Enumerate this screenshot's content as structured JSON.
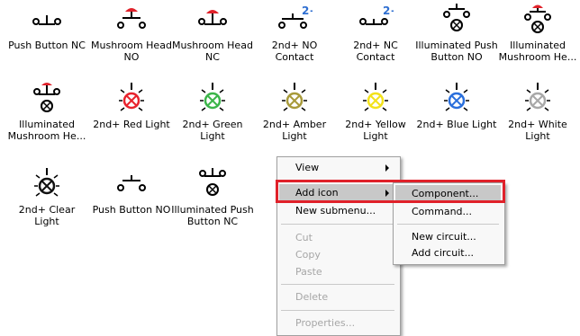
{
  "icons": [
    {
      "label": "Push Button NC",
      "icon": "push-button-nc-icon"
    },
    {
      "label": "Mushroom Head NO",
      "icon": "mushroom-head-no-icon",
      "accent": "#e0212a"
    },
    {
      "label": "Mushroom Head NC",
      "icon": "mushroom-head-nc-icon",
      "accent": "#e0212a"
    },
    {
      "label": "2nd+ NO Contact",
      "icon": "no-contact-icon",
      "badge": "2+"
    },
    {
      "label": "2nd+ NC Contact",
      "icon": "nc-contact-icon",
      "badge": "2+"
    },
    {
      "label": "Illuminated Push Button NO",
      "icon": "illuminated-push-button-no-icon"
    },
    {
      "label": "Illuminated Mushroom He...",
      "icon": "illuminated-mushroom-head-icon",
      "accent": "#e0212a"
    },
    {
      "label": "Illuminated Mushroom He...",
      "icon": "illuminated-mushroom-head-nc-icon",
      "accent": "#e0212a"
    },
    {
      "label": "2nd+ Red Light",
      "icon": "red-light-icon",
      "color": "#e8232d"
    },
    {
      "label": "2nd+ Green Light",
      "icon": "green-light-icon",
      "color": "#3cb54a"
    },
    {
      "label": "2nd+ Amber Light",
      "icon": "amber-light-icon",
      "color": "#a89a3a"
    },
    {
      "label": "2nd+ Yellow Light",
      "icon": "yellow-light-icon",
      "color": "#f3e21b"
    },
    {
      "label": "2nd+ Blue Light",
      "icon": "blue-light-icon",
      "color": "#2a6fdc"
    },
    {
      "label": "2nd+ White Light",
      "icon": "white-light-icon",
      "color": "#a8a8a8"
    },
    {
      "label": "2nd+ Clear Light",
      "icon": "clear-light-icon",
      "color": "#111111"
    },
    {
      "label": "Push Button NO",
      "icon": "push-button-no-icon"
    },
    {
      "label": "Illuminated Push Button NC",
      "icon": "illuminated-push-button-nc-icon"
    }
  ],
  "badge_color": "#2f6fd1",
  "context_menu": {
    "items": [
      {
        "label": "View",
        "submenu": true
      },
      {
        "label": "Add icon",
        "submenu": true,
        "highlighted": true
      },
      {
        "label": "New submenu..."
      },
      {
        "label": "Cut",
        "disabled": true
      },
      {
        "label": "Copy",
        "disabled": true
      },
      {
        "label": "Paste",
        "disabled": true
      },
      {
        "label": "Delete",
        "disabled": true
      },
      {
        "label": "Properties...",
        "disabled": true
      }
    ]
  },
  "submenu": {
    "items": [
      {
        "label": "Component...",
        "highlighted": true
      },
      {
        "label": "Command..."
      },
      {
        "label": "New circuit..."
      },
      {
        "label": "Add circuit..."
      }
    ]
  },
  "highlight_color": "#e0212a"
}
